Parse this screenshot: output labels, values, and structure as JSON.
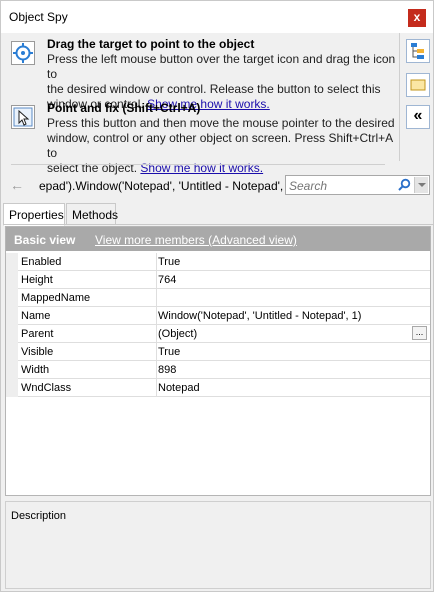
{
  "window": {
    "title": "Object Spy",
    "close_label": "x"
  },
  "drag_section": {
    "heading": "Drag the target to point to the object",
    "desc_line1": "Press the left mouse button over the target icon and drag the icon to",
    "desc_line2": "the desired window or control. Release the button to select this",
    "desc_line3": "window or control.",
    "link": "Show me how it works."
  },
  "fix_section": {
    "heading": "Point and fix (Shift+Ctrl+A)",
    "desc_line1": "Press this button and then move the mouse pointer to the desired",
    "desc_line2": "window, control or any other object on screen. Press Shift+Ctrl+A to",
    "desc_line3": "select the object.",
    "link": "Show me how it works."
  },
  "side_buttons": [
    "hierarchy-icon",
    "window-icon",
    "collapse-icon"
  ],
  "collapse_glyph": "«",
  "path": {
    "text": "epad').Window('Notepad', 'Untitled - Notepad', 1)"
  },
  "search": {
    "placeholder": "Search"
  },
  "tabs": [
    {
      "label": "Properties",
      "active": true
    },
    {
      "label": "Methods",
      "active": false
    }
  ],
  "grid": {
    "view_label": "Basic view",
    "advanced_link": "View more members (Advanced view)",
    "rows": [
      {
        "name": "Enabled",
        "value": "True"
      },
      {
        "name": "Height",
        "value": "764"
      },
      {
        "name": "MappedName",
        "value": ""
      },
      {
        "name": "Name",
        "value": "Window('Notepad', 'Untitled - Notepad', 1)"
      },
      {
        "name": "Parent",
        "value": "(Object)"
      },
      {
        "name": "Visible",
        "value": "True"
      },
      {
        "name": "Width",
        "value": "898"
      },
      {
        "name": "WndClass",
        "value": "Notepad"
      }
    ],
    "ellipsis_label": "..."
  },
  "description": {
    "label": "Description"
  },
  "colors": {
    "accent": "#0078d7",
    "header_bg": "#a9a9a9",
    "close_bg": "#c42b1c",
    "link": "#1a0dab"
  }
}
